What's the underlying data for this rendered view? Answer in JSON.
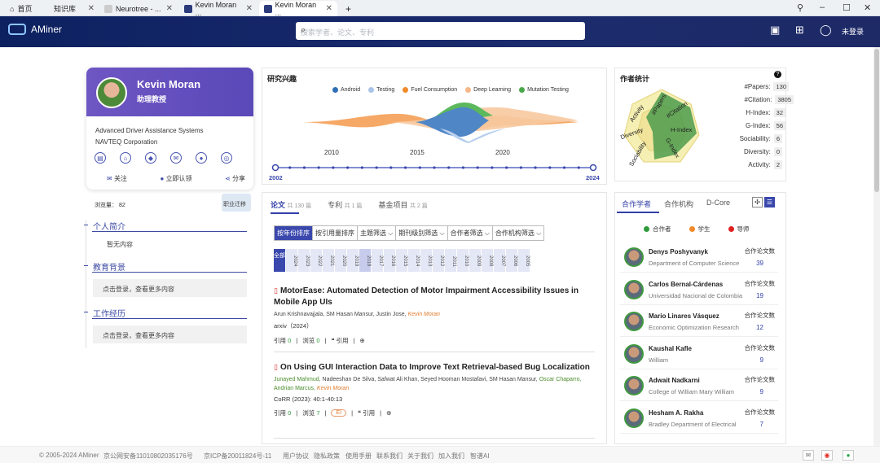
{
  "browser": {
    "home": "首页",
    "tabs": [
      {
        "label": "知识库"
      },
      {
        "label": "Neurotree - ..."
      },
      {
        "label": "Kevin Moran ..."
      },
      {
        "label": "Kevin Moran ..."
      }
    ],
    "new_tab": "+"
  },
  "header": {
    "brand": "AMiner",
    "search_placeholder": "搜索学者、论文、专利",
    "login": "未登录"
  },
  "profile": {
    "name": "Kevin Moran",
    "title": "助理教授",
    "affiliation_1": "Advanced Driver Assistance Systems",
    "affiliation_2": "NAVTEQ Corporation",
    "follow": "关注",
    "claim": "立即认领",
    "share": "分享",
    "views_label": "浏览量：",
    "views": "82",
    "career_trail": "职业迁移"
  },
  "sections": {
    "intro": "个人简介",
    "intro_empty": "暂无内容",
    "education": "教育背景",
    "education_login": "点击登录，查看更多内容",
    "work": "工作经历",
    "work_login": "点击登录，查看更多内容"
  },
  "interest": {
    "title": "研究兴趣",
    "legend": [
      {
        "name": "Android",
        "color": "#2f6fb5"
      },
      {
        "name": "Testing",
        "color": "#a9c4e8"
      },
      {
        "name": "Fuel Consumption",
        "color": "#f08a2a"
      },
      {
        "name": "Deep Learning",
        "color": "#f5b888"
      },
      {
        "name": "Mutation Testing",
        "color": "#4aa84a"
      }
    ],
    "axis": [
      "2010",
      "2015",
      "2020"
    ],
    "range_start": "2002",
    "range_end": "2024"
  },
  "stats": {
    "title": "作者统计",
    "help": "?",
    "rows": [
      {
        "label": "#Papers:",
        "value": "130"
      },
      {
        "label": "#Citation:",
        "value": "3805"
      },
      {
        "label": "H-Index:",
        "value": "32"
      },
      {
        "label": "G-Index:",
        "value": "56"
      },
      {
        "label": "Sociability:",
        "value": "6"
      },
      {
        "label": "Diversity:",
        "value": "0"
      },
      {
        "label": "Activity:",
        "value": "2"
      }
    ],
    "radar_labels": [
      "#Papers",
      "#Citation",
      "H-Index",
      "G-Index",
      "Sociability",
      "Diversity",
      "Activity"
    ]
  },
  "papers": {
    "tabs": [
      {
        "label": "论文",
        "count": "共 130 篇"
      },
      {
        "label": "专利",
        "count": "共 1 篇"
      },
      {
        "label": "基金项目",
        "count": "共 2 篇"
      }
    ],
    "filters": [
      "按年份排序",
      "按引用量排序",
      "主题筛选 ⌵",
      "期刊级别筛选 ⌵",
      "合作者筛选 ⌵",
      "合作机构筛选 ⌵"
    ],
    "all_label": "全部",
    "years": [
      "2024",
      "2023",
      "2022",
      "2021",
      "2020",
      "2019",
      "2018",
      "2017",
      "2016",
      "2015",
      "2014",
      "2013",
      "2012",
      "2011",
      "2010",
      "2009",
      "2008",
      "2007",
      "2006",
      "2005"
    ],
    "items": [
      {
        "title": "MotorEase: Automated Detection of Motor Impairment Accessibility Issues in Mobile App UIs",
        "authors": "Arun Krishnavajjala, SM Hasan Mansur, Justin Jose,",
        "highlight": "Kevin Moran",
        "venue": "arxiv（2024）",
        "cite_label": "引用",
        "cite": "0",
        "view_label": "浏览",
        "views": "0",
        "ref": "引用"
      },
      {
        "title": "On Using GUI Interaction Data to Improve Text Retrieval-based Bug Localization",
        "authors_green": "Junayed Mahmud,",
        "authors": "Nadeeshan De Silva, Safwat Ali Khan, Seyed Hooman Mostafavi, SM Hasan Mansur,",
        "authors_green2": "Oscar Chaparro, Andrian Marcus,",
        "highlight": "Kevin Moran",
        "venue": "CoRR (2023): 40:1-40:13",
        "cite_label": "引用",
        "cite": "0",
        "view_label": "浏览",
        "views": "7",
        "badge": "EI",
        "ref": "引用"
      }
    ]
  },
  "collab": {
    "tabs": [
      "合作学者",
      "合作机构",
      "D-Core"
    ],
    "legend": [
      {
        "name": "合作者",
        "color": "#2f9a3a"
      },
      {
        "name": "学生",
        "color": "#f08a2a"
      },
      {
        "name": "导师",
        "color": "#e02020"
      }
    ],
    "papers_label": "合作论文数",
    "people": [
      {
        "name": "Denys Poshyvanyk",
        "aff": "Department of Computer Science",
        "count": "39"
      },
      {
        "name": "Carlos Bernal-Cárdenas",
        "aff": "Universidad Nacional de Colombia",
        "count": "19"
      },
      {
        "name": "Mario Linares Vásquez",
        "aff": "Economic Optimization Research",
        "count": "12"
      },
      {
        "name": "Kaushal Kafle",
        "aff": "William",
        "count": "9"
      },
      {
        "name": "Adwait Nadkarni",
        "aff": "College of William Mary William",
        "count": "9"
      },
      {
        "name": "Hesham A. Rakha",
        "aff": "Bradley Department of Electrical",
        "count": "7"
      }
    ]
  },
  "footer": {
    "copy": "© 2005-2024 AMiner",
    "beian": "京公网安备11010802035176号",
    "icp": "京ICP备20011824号-11",
    "links": [
      "用户协议",
      "隐私政策",
      "使用手册",
      "联系我们",
      "关于我们",
      "加入我们",
      "智谱AI"
    ]
  }
}
